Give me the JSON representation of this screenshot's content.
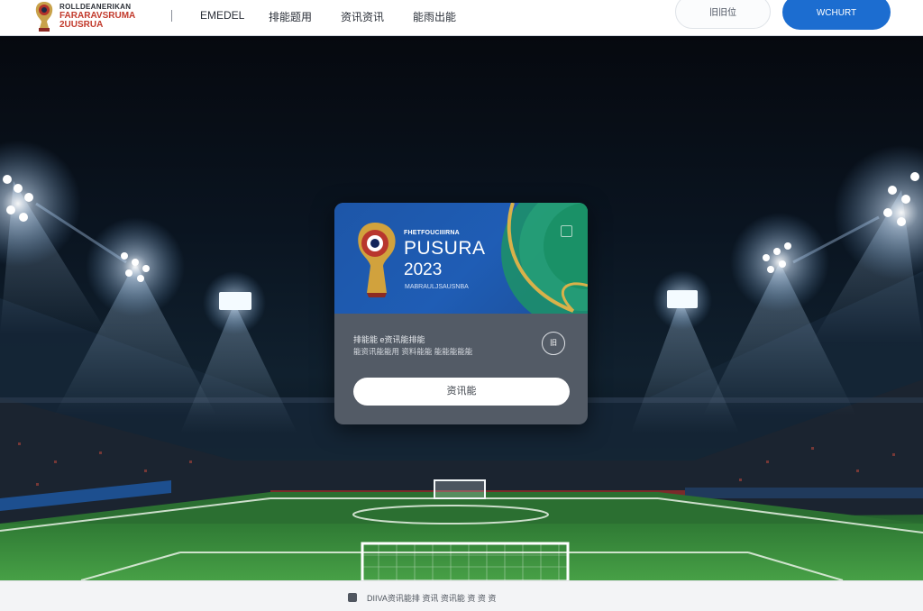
{
  "header": {
    "logo": {
      "line1": "ROLLDEANERIKAN",
      "line2": "FARARAVSRUMA",
      "line3": "2UUSRUA"
    },
    "nav": [
      {
        "label": "EMEDEL"
      },
      {
        "label": "排能题用"
      },
      {
        "label": "资讯资讯"
      },
      {
        "label": "能雨出能"
      }
    ],
    "ghost_button": "旧旧位",
    "primary_button": "WCHURT"
  },
  "card": {
    "banner": {
      "small_text": "FHETFOUCIIIRNA",
      "title": "PUSURA",
      "year": "2023",
      "subtitle": "MABRAULJSAUSNBA"
    },
    "info_line1": "排能能 e资讯能排能",
    "info_line2": "能资讯能能用 资料能能 能能能能能",
    "circle_button": "旧",
    "action_button": "资讯能"
  },
  "footer": {
    "icon": "copyright-icon",
    "text": "DIIVA资讯能排 资讯 资讯能 资 资 资"
  },
  "colors": {
    "primary": "#1c6dd0",
    "card_banner": "#1f5db5",
    "card_body": "#535b66",
    "pitch": "#3b8f3e"
  }
}
